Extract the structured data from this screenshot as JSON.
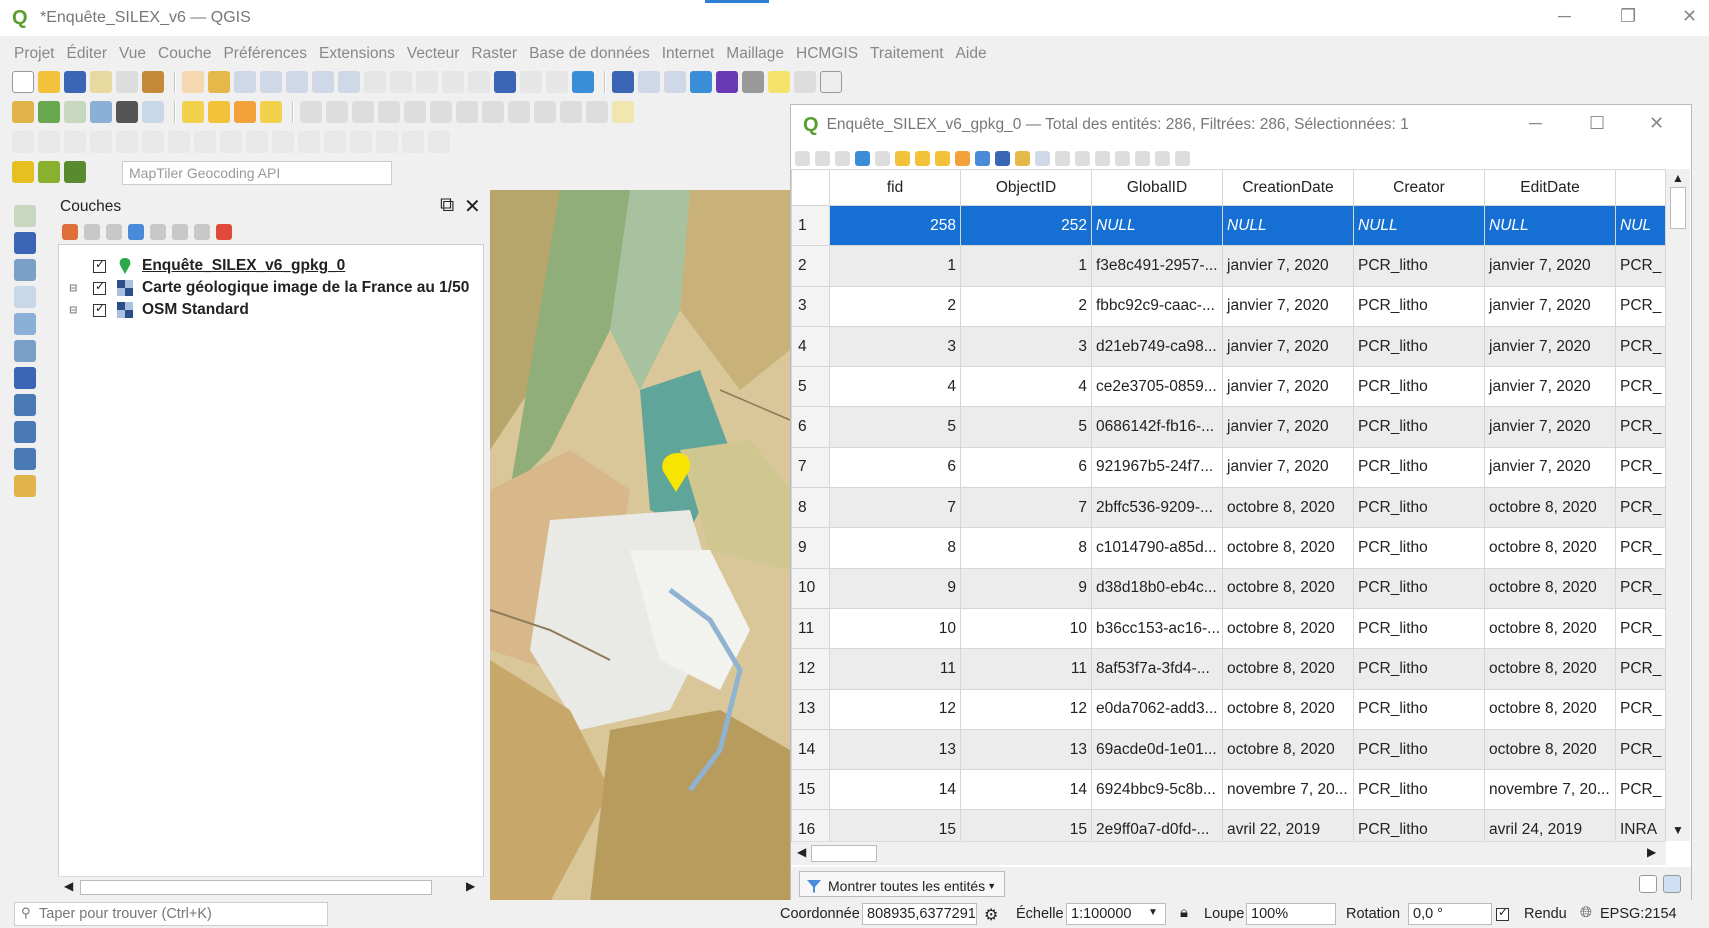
{
  "window": {
    "title": "*Enquête_SILEX_v6 — QGIS"
  },
  "menu": [
    "Projet",
    "Éditer",
    "Vue",
    "Couche",
    "Préférences",
    "Extensions",
    "Vecteur",
    "Raster",
    "Base de données",
    "Internet",
    "Maillage",
    "HCMGIS",
    "Traitement",
    "Aide"
  ],
  "geocode": {
    "placeholder": "MapTiler Geocoding API"
  },
  "layers_panel": {
    "title": "Couches",
    "layers": [
      {
        "name": "Enquête_SILEX_v6_gpkg_0",
        "icon": "point-marker-icon"
      },
      {
        "name": "Carte géologique image de la France au 1/50",
        "icon": "raster-grid-icon"
      },
      {
        "name": "OSM Standard",
        "icon": "raster-grid-icon"
      }
    ]
  },
  "attribute_table": {
    "title": "Enquête_SILEX_v6_gpkg_0 — Total des entités: 286, Filtrées: 286, Sélectionnées: 1",
    "columns": [
      "fid",
      "ObjectID",
      "GlobalID",
      "CreationDate",
      "Creator",
      "EditDate",
      ""
    ],
    "rows": [
      [
        "1",
        "258",
        "252",
        "NULL",
        "NULL",
        "NULL",
        "NULL",
        "NUL"
      ],
      [
        "2",
        "1",
        "1",
        "f3e8c491-2957-...",
        "janvier 7, 2020",
        "PCR_litho",
        "janvier 7, 2020",
        "PCR_"
      ],
      [
        "3",
        "2",
        "2",
        "fbbc92c9-caac-...",
        "janvier 7, 2020",
        "PCR_litho",
        "janvier 7, 2020",
        "PCR_"
      ],
      [
        "4",
        "3",
        "3",
        "d21eb749-ca98...",
        "janvier 7, 2020",
        "PCR_litho",
        "janvier 7, 2020",
        "PCR_"
      ],
      [
        "5",
        "4",
        "4",
        "ce2e3705-0859...",
        "janvier 7, 2020",
        "PCR_litho",
        "janvier 7, 2020",
        "PCR_"
      ],
      [
        "6",
        "5",
        "5",
        "0686142f-fb16-...",
        "janvier 7, 2020",
        "PCR_litho",
        "janvier 7, 2020",
        "PCR_"
      ],
      [
        "7",
        "6",
        "6",
        "921967b5-24f7...",
        "janvier 7, 2020",
        "PCR_litho",
        "janvier 7, 2020",
        "PCR_"
      ],
      [
        "8",
        "7",
        "7",
        "2bffc536-9209-...",
        "octobre 8, 2020",
        "PCR_litho",
        "octobre 8, 2020",
        "PCR_"
      ],
      [
        "9",
        "8",
        "8",
        "c1014790-a85d...",
        "octobre 8, 2020",
        "PCR_litho",
        "octobre 8, 2020",
        "PCR_"
      ],
      [
        "10",
        "9",
        "9",
        "d38d18b0-eb4c...",
        "octobre 8, 2020",
        "PCR_litho",
        "octobre 8, 2020",
        "PCR_"
      ],
      [
        "11",
        "10",
        "10",
        "b36cc153-ac16-...",
        "octobre 8, 2020",
        "PCR_litho",
        "octobre 8, 2020",
        "PCR_"
      ],
      [
        "12",
        "11",
        "11",
        "8af53f7a-3fd4-...",
        "octobre 8, 2020",
        "PCR_litho",
        "octobre 8, 2020",
        "PCR_"
      ],
      [
        "13",
        "12",
        "12",
        "e0da7062-add3...",
        "octobre 8, 2020",
        "PCR_litho",
        "octobre 8, 2020",
        "PCR_"
      ],
      [
        "14",
        "13",
        "13",
        "69acde0d-1e01...",
        "octobre 8, 2020",
        "PCR_litho",
        "octobre 8, 2020",
        "PCR_"
      ],
      [
        "15",
        "14",
        "14",
        "6924bbc9-5c8b...",
        "novembre 7, 20...",
        "PCR_litho",
        "novembre 7, 20...",
        "PCR_"
      ],
      [
        "16",
        "15",
        "15",
        "2e9ff0a7-d0fd-...",
        "avril 22, 2019",
        "PCR_litho",
        "avril 24, 2019",
        "INRA"
      ]
    ],
    "selected_row": 0,
    "footer_button": "Montrer toutes les entités"
  },
  "status": {
    "search_placeholder": "Taper pour trouver (Ctrl+K)",
    "coord_label": "Coordonnée",
    "coord_value": "808935,6377291",
    "scale_label": "Échelle",
    "scale_value": "1:100000",
    "magnifier_label": "Loupe",
    "magnifier_value": "100%",
    "rotation_label": "Rotation",
    "rotation_value": "0,0 °",
    "render_label": "Rendu",
    "crs": "EPSG:2154"
  },
  "colors": {
    "selection": "#1670d4",
    "qgis_green": "#5a9e2f",
    "marker": "#f7e400"
  }
}
